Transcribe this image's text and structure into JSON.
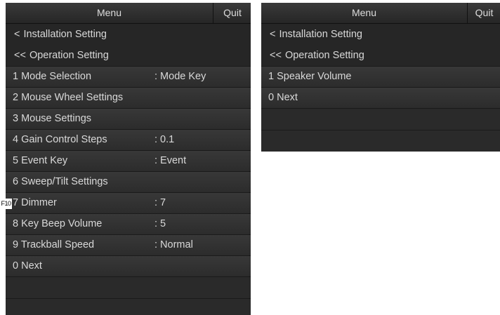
{
  "left_menu": {
    "title": "Menu",
    "quit": "Quit",
    "nav": [
      {
        "chevron": "<",
        "label": "Installation Setting"
      },
      {
        "chevron": "<<",
        "label": "Operation Setting"
      }
    ],
    "items": [
      {
        "label": "1 Mode Selection",
        "value": ": Mode Key"
      },
      {
        "label": "2 Mouse Wheel Settings",
        "value": ""
      },
      {
        "label": "3 Mouse Settings",
        "value": ""
      },
      {
        "label": "4 Gain Control Steps",
        "value": ": 0.1"
      },
      {
        "label": "5 Event Key",
        "value": ": Event"
      },
      {
        "label": "6 Sweep/Tilt Settings",
        "value": ""
      },
      {
        "label": "7 Dimmer",
        "value": ": 7"
      },
      {
        "label": "8 Key Beep Volume",
        "value": ": 5"
      },
      {
        "label": "9 Trackball Speed",
        "value": ": Normal"
      },
      {
        "label": "0 Next",
        "value": ""
      }
    ],
    "key_badge": "F10"
  },
  "right_menu": {
    "title": "Menu",
    "quit": "Quit",
    "nav": [
      {
        "chevron": "<",
        "label": "Installation Setting"
      },
      {
        "chevron": "<<",
        "label": "Operation Setting"
      }
    ],
    "items": [
      {
        "label": "1 Speaker Volume",
        "value": ""
      },
      {
        "label": "0 Next",
        "value": ""
      }
    ]
  }
}
